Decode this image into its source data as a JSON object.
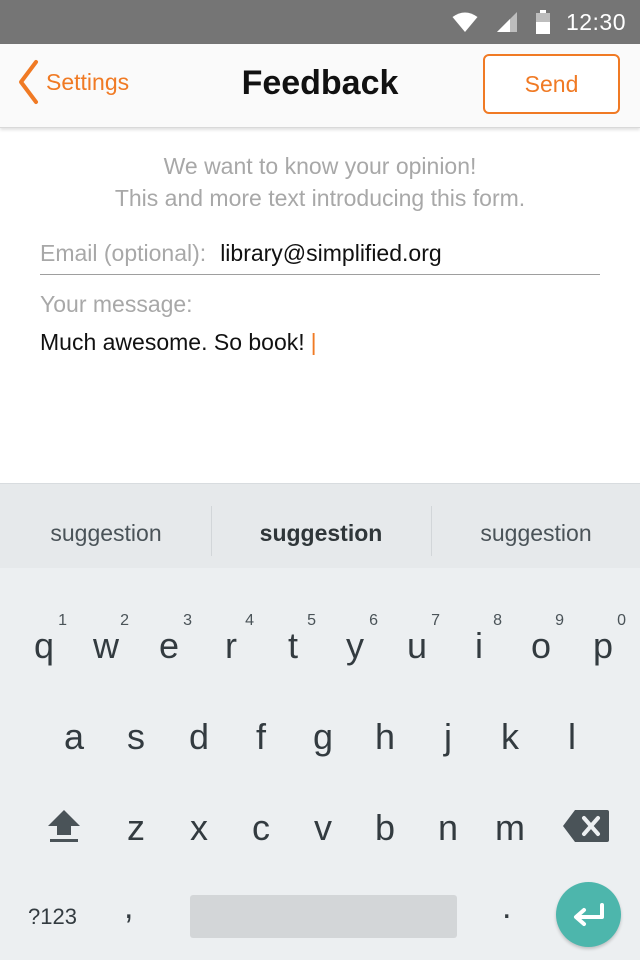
{
  "status_bar": {
    "time": "12:30",
    "icons": [
      "wifi-icon",
      "signal-icon",
      "battery-icon"
    ],
    "color": "#757575"
  },
  "nav": {
    "back_label": "Settings",
    "title": "Feedback",
    "send_label": "Send",
    "accent_color": "#f07a24"
  },
  "form": {
    "intro_line1": "We want to know your opinion!",
    "intro_line2": "This and more text introducing this form.",
    "email_label": "Email (optional):",
    "email_value": "library@simplified.org",
    "message_label": "Your message:",
    "message_value": "Much awesome. So book!"
  },
  "keyboard": {
    "suggestions": [
      "suggestion",
      "suggestion",
      "suggestion"
    ],
    "row1": [
      {
        "key": "q",
        "hint": "1"
      },
      {
        "key": "w",
        "hint": "2"
      },
      {
        "key": "e",
        "hint": "3"
      },
      {
        "key": "r",
        "hint": "4"
      },
      {
        "key": "t",
        "hint": "5"
      },
      {
        "key": "y",
        "hint": "6"
      },
      {
        "key": "u",
        "hint": "7"
      },
      {
        "key": "i",
        "hint": "8"
      },
      {
        "key": "o",
        "hint": "9"
      },
      {
        "key": "p",
        "hint": "0"
      }
    ],
    "row2": [
      "a",
      "s",
      "d",
      "f",
      "g",
      "h",
      "j",
      "k",
      "l"
    ],
    "row3": [
      "z",
      "x",
      "c",
      "v",
      "b",
      "n",
      "m"
    ],
    "symbols_label": "?123",
    "comma": ",",
    "period": ".",
    "enter_color": "#4db6ac"
  }
}
